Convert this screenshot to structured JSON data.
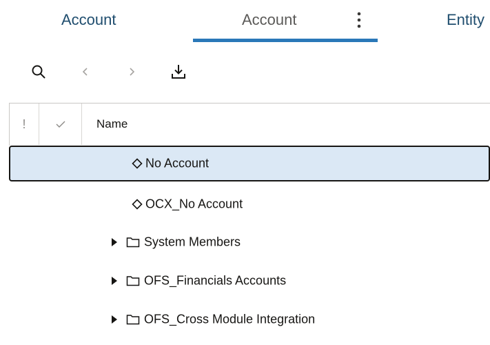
{
  "tabs": [
    {
      "label": "Account"
    },
    {
      "label": "Account"
    },
    {
      "label": "Entity"
    }
  ],
  "toolbar": {
    "search_icon": "search-icon",
    "back_icon": "chevron-left-icon",
    "forward_icon": "chevron-right-icon",
    "export_icon": "download-icon"
  },
  "grid": {
    "header": {
      "status_col": "!",
      "name_col": "Name"
    },
    "rows": [
      {
        "label": "No Account",
        "icon": "diamond-icon",
        "expandable": false,
        "selected": true
      },
      {
        "label": "OCX_No Account",
        "icon": "diamond-icon",
        "expandable": false,
        "selected": false
      },
      {
        "label": "System Members",
        "icon": "folder-icon",
        "expandable": true,
        "selected": false
      },
      {
        "label": "OFS_Financials Accounts",
        "icon": "folder-icon",
        "expandable": true,
        "selected": false
      },
      {
        "label": "OFS_Cross Module Integration",
        "icon": "folder-icon",
        "expandable": true,
        "selected": false
      }
    ]
  },
  "colors": {
    "accent": "#2a78b8",
    "tab_text": "#1f4d6e",
    "selected_row": "#dbe8f5"
  }
}
